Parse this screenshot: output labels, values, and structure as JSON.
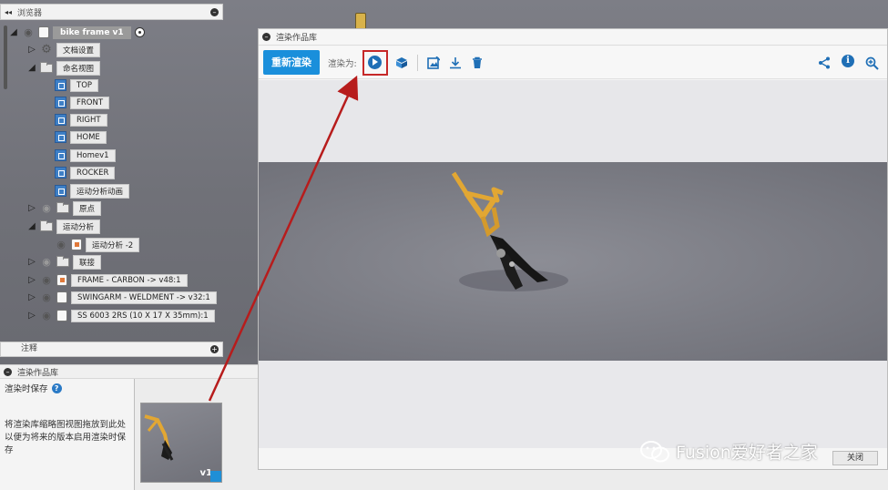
{
  "browser": {
    "collapse_icon": "◂◂",
    "title": "浏览器",
    "root": {
      "label": "bike frame v1"
    },
    "items": [
      {
        "label": "文档设置"
      },
      {
        "label": "命名视图"
      },
      {
        "label": "TOP"
      },
      {
        "label": "FRONT"
      },
      {
        "label": "RIGHT"
      },
      {
        "label": "HOME"
      },
      {
        "label": "Homev1"
      },
      {
        "label": "ROCKER"
      },
      {
        "label": "运动分析动画"
      },
      {
        "label": "原点"
      },
      {
        "label": "运动分析"
      },
      {
        "label": "运动分析 -2"
      },
      {
        "label": "联接"
      },
      {
        "label": "FRAME - CARBON -> v48:1"
      },
      {
        "label": "SWINGARM - WELDMENT -> v32:1"
      },
      {
        "label": "SS 6003 2RS (10 X 17 X 35mm):1"
      }
    ]
  },
  "notes": {
    "title": "注释"
  },
  "gallery_panel": {
    "title": "渲染作品库",
    "save_on_render": "渲染时保存",
    "hint": "将渲染库缩略图视图拖放到此处以便为将来的版本启用渲染时保存",
    "thumb_label": "v1"
  },
  "dialog": {
    "title": "渲染作品库",
    "rerender_button": "重新渲染",
    "render_as": "渲染为:",
    "close_button": "关闭"
  },
  "watermark": {
    "text": "Fusion爱好者之家"
  },
  "colors": {
    "accent": "#1a8fdb",
    "icon_blue": "#1f6fb6",
    "highlight_red": "#c62828",
    "frame_yellow": "#e2a733"
  }
}
